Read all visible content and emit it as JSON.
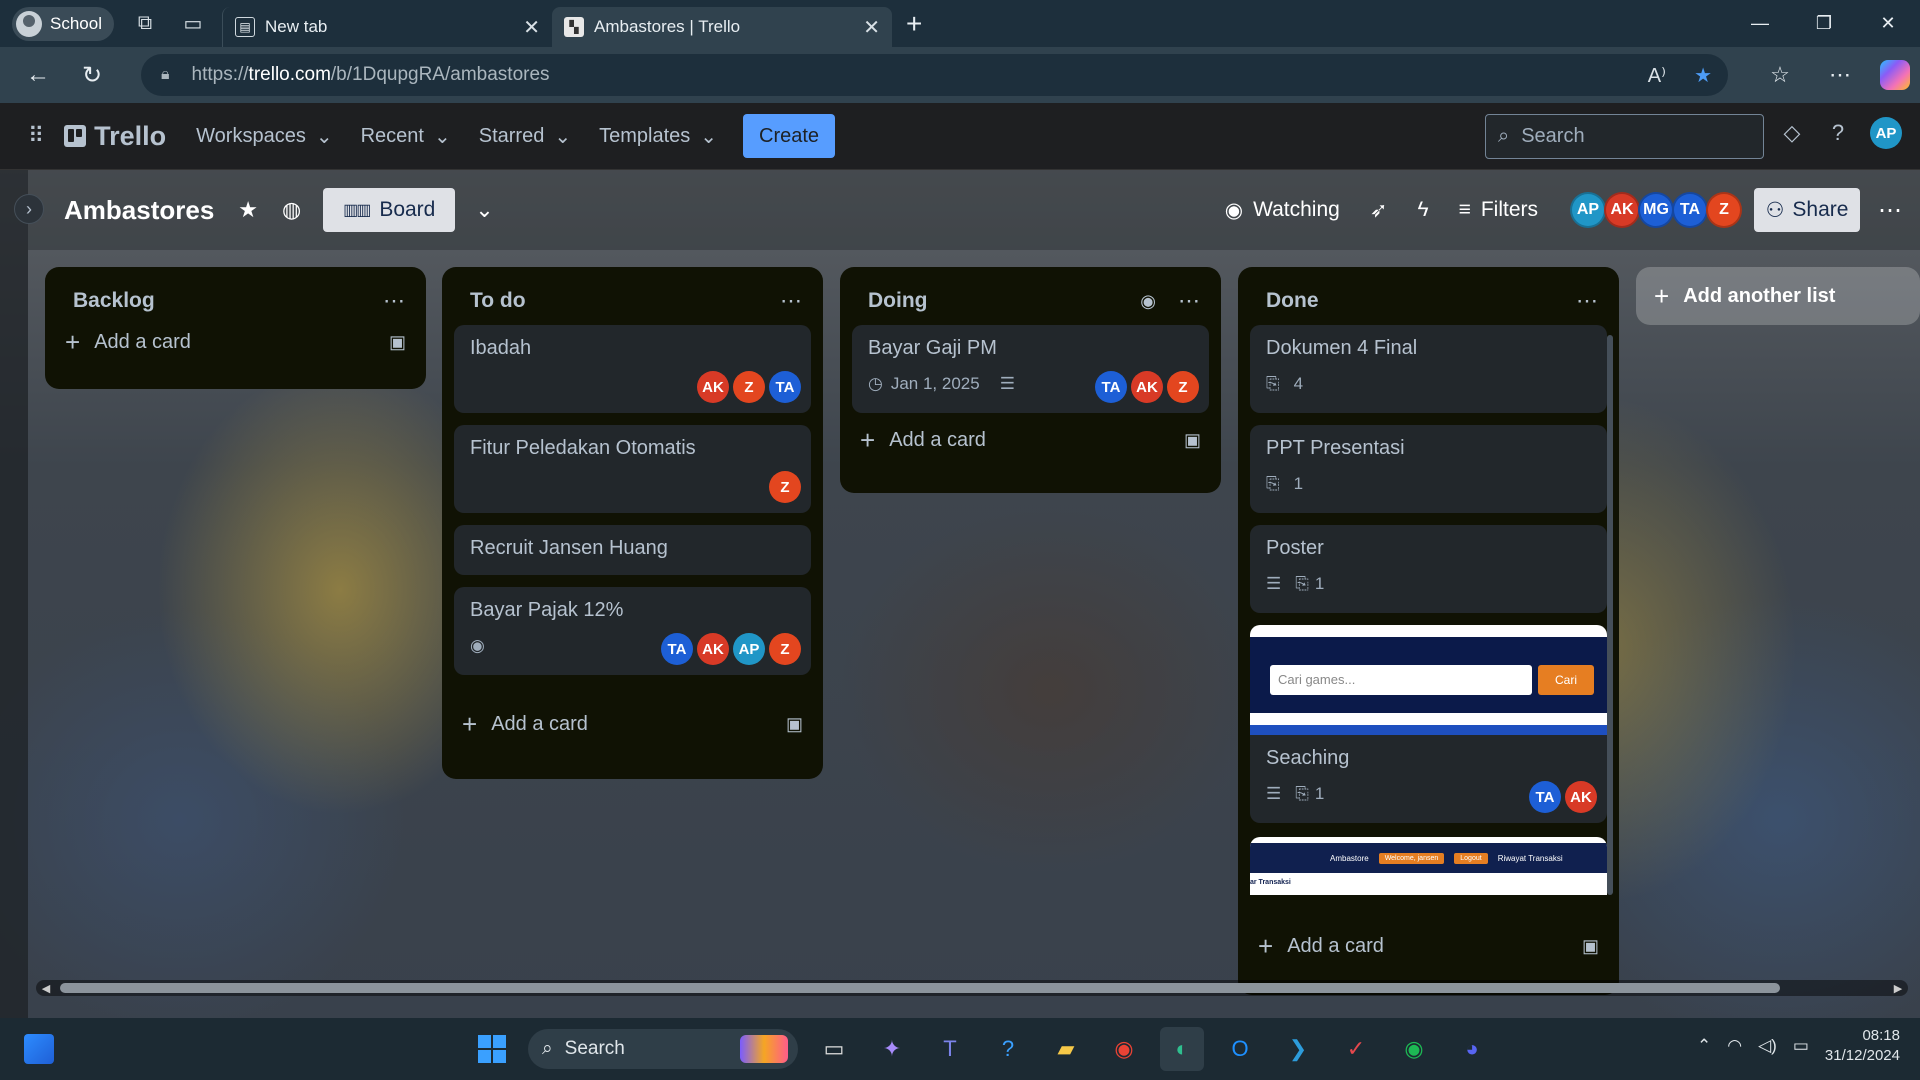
{
  "browser": {
    "profile_label": "School",
    "tabs": [
      {
        "title": "New tab",
        "active": false
      },
      {
        "title": "Ambastores | Trello",
        "active": true
      }
    ],
    "url_prefix": "https://",
    "url_host": "trello.com",
    "url_path": "/b/1DqupgRA/ambastores"
  },
  "trello": {
    "logo_text": "Trello",
    "nav": [
      "Workspaces",
      "Recent",
      "Starred",
      "Templates"
    ],
    "create_label": "Create",
    "search_placeholder": "Search",
    "user_initials": "AP",
    "accent_color": "#579dff"
  },
  "board": {
    "title": "Ambastores",
    "view_label": "Board",
    "watching_label": "Watching",
    "filters_label": "Filters",
    "share_label": "Share",
    "members": [
      {
        "initials": "AP",
        "color": "#2096c7"
      },
      {
        "initials": "AK",
        "color": "#d83a26"
      },
      {
        "initials": "MG",
        "color": "#1d5fd6"
      },
      {
        "initials": "TA",
        "color": "#1d5fd6"
      },
      {
        "initials": "Z",
        "color": "#e3461f"
      }
    ],
    "add_list_label": "Add another list",
    "add_card_label": "Add a card",
    "lists": [
      {
        "title": "Backlog",
        "cards": []
      },
      {
        "title": "To do",
        "cards": [
          {
            "title": "Ibadah",
            "members": [
              "AK",
              "Z",
              "TA"
            ]
          },
          {
            "title": "Fitur Peledakan Otomatis",
            "members": [
              "Z"
            ]
          },
          {
            "title": "Recruit Jansen Huang",
            "members": []
          },
          {
            "title": "Bayar Pajak 12%",
            "members": [
              "TA",
              "AK",
              "AP",
              "Z"
            ],
            "watching": true
          }
        ]
      },
      {
        "title": "Doing",
        "cards": [
          {
            "title": "Bayar Gaji PM",
            "due": "Jan 1, 2025",
            "has_description": true,
            "members": [
              "TA",
              "AK",
              "Z"
            ]
          }
        ]
      },
      {
        "title": "Done",
        "cards": [
          {
            "title": "Dokumen 4 Final",
            "attachments": "4"
          },
          {
            "title": "PPT Presentasi",
            "attachments": "1"
          },
          {
            "title": "Poster",
            "has_description": true,
            "attachments": "1"
          },
          {
            "title": "Seaching",
            "has_description": true,
            "attachments": "1",
            "members": [
              "TA",
              "AK"
            ],
            "cover_text": {
              "search_placeholder": "Cari games...",
              "button": "Cari"
            }
          },
          {
            "title": "",
            "cover_text": {
              "brand": "Ambastore",
              "pill_1": "Welcome, jansen",
              "pill_2": "Logout",
              "link": "Riwayat Transaksi",
              "sub": "ar Transaksi"
            }
          }
        ]
      }
    ]
  },
  "taskbar": {
    "search_label": "Search",
    "time": "08:18",
    "date": "31/12/2024"
  }
}
